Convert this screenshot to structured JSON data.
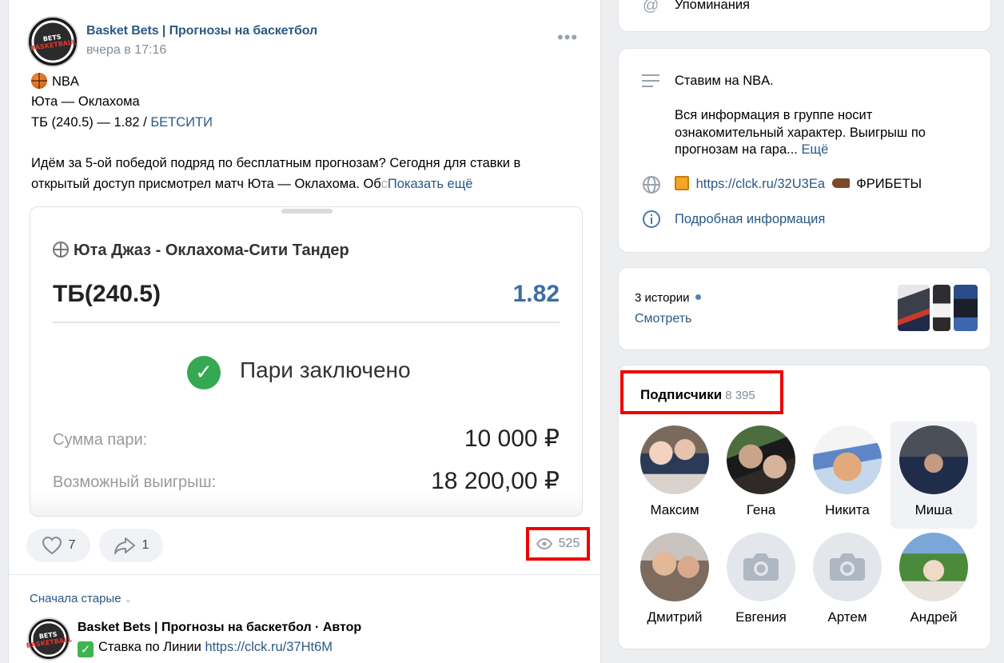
{
  "post": {
    "group_name": "Basket Bets | Прогнозы на баскетбол",
    "time": "вчера в 17:16",
    "more_icon": "more-horizontal-icon",
    "lines": {
      "league": "NBA",
      "match": "Юта — Оклахома",
      "bet_prefix": "ТБ (240.5) — 1.82 / ",
      "bookmaker": "БЕТСИТИ",
      "para1": "Идём за 5-ой победой подряд по бесплатным прогнозам? Сегодня для ставки в",
      "para2": "открытый доступ присмотрел матч Юта — Оклахома. Об",
      "para2_fade": "с",
      "show_more": "Показать ещё"
    },
    "slip": {
      "match": "Юта Джаз - Оклахома-Сити Тандер",
      "market": "ТБ(240.5)",
      "odds": "1.82",
      "status": "Пари заключено",
      "stake_label": "Сумма пари:",
      "stake_value": "10 000 ₽",
      "win_label": "Возможный выигрыш:",
      "win_value": "18 200,00 ₽"
    },
    "likes": "7",
    "shares": "1",
    "views": "525"
  },
  "comments": {
    "sort_label": "Сначала старые",
    "first": {
      "group": "Basket Bets | Прогнозы на баскетбол",
      "author_suffix": " · Автор",
      "text": "Ставка по Линии ",
      "link": "https://clck.ru/37Ht6M"
    }
  },
  "sidebar": {
    "mentions_label": "Упоминания",
    "description": {
      "title": "Ставим на NBA.",
      "body1": "Вся информация в группе носит",
      "body2": "ознакомительный характер. Выигрыш по",
      "body3": "прогнозам на гара...",
      "more": "Ещё"
    },
    "link": {
      "url": "https://clck.ru/32U3Ea",
      "suffix": "ФРИБЕТЫ"
    },
    "info_label": "Подробная информация",
    "stories": {
      "count_label": "3 истории",
      "watch_label": "Смотреть"
    },
    "subscribers": {
      "title": "Подписчики",
      "count": "8 395",
      "people": [
        {
          "name": "Максим"
        },
        {
          "name": "Гена"
        },
        {
          "name": "Никита"
        },
        {
          "name": "Миша"
        },
        {
          "name": "Дмитрий"
        },
        {
          "name": "Евгения"
        },
        {
          "name": "Артем"
        },
        {
          "name": "Андрей"
        }
      ]
    }
  },
  "colors": {
    "link": "#2a5885",
    "highlight_box": "#e00000",
    "odds": "#3d6ea3",
    "success": "#34a853"
  }
}
